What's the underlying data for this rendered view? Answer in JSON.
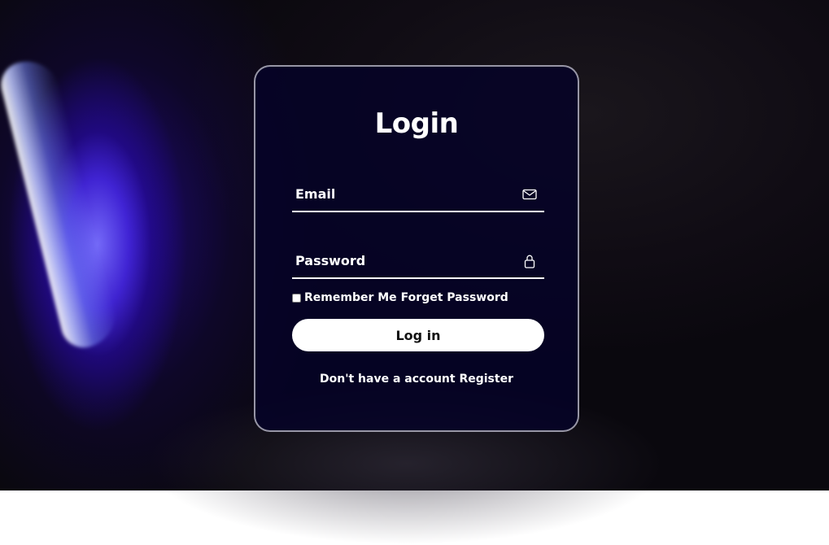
{
  "colors": {
    "card_background": "#05022a",
    "card_border": "#c8c8d2",
    "text": "#ffffff",
    "button_background": "#ffffff",
    "button_text": "#111111",
    "accent_glow": "#4628e6"
  },
  "login": {
    "title": "Login",
    "email": {
      "placeholder": "Email",
      "value": "",
      "icon": "mail-icon"
    },
    "password": {
      "placeholder": "Password",
      "value": "",
      "icon": "lock-icon"
    },
    "remember_me": {
      "label": "Remember Me",
      "checked": false
    },
    "forget_password_label": "Forget Password",
    "submit_label": "Log in",
    "register_prompt": "Don't have a account",
    "register_link_label": "Register"
  }
}
